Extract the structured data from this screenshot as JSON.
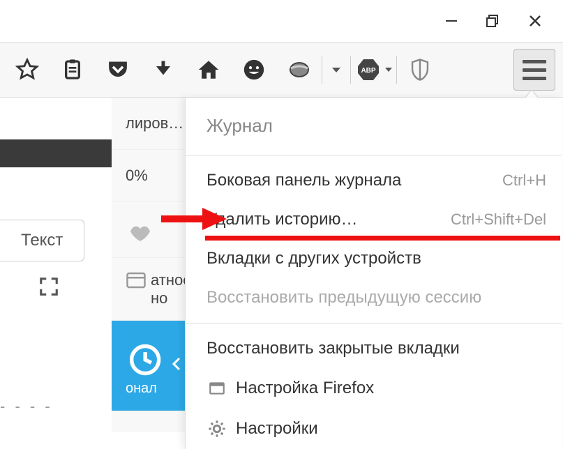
{
  "window_controls": {
    "minimize": "—",
    "maximize": "❐",
    "close": "✕"
  },
  "toolbar": {
    "icons": [
      "star",
      "clipboard",
      "pocket",
      "download",
      "home",
      "smiley",
      "ie",
      "dropdown",
      "abp",
      "shield",
      "hamburger"
    ]
  },
  "background": {
    "truncated_top": "лиров…",
    "percent": "0%",
    "tab_label": "Текст",
    "truncated_mid1": "атное",
    "truncated_mid2": "но",
    "truncated_blue": "онал",
    "dashes": "- - - -"
  },
  "sidebar": {
    "items": [
      {
        "icon": "kiss",
        "label": ""
      },
      {
        "icon": "private",
        "line1": "атное",
        "line2": "но"
      },
      {
        "icon": "history",
        "label": "онал"
      }
    ]
  },
  "menu": {
    "title": "Журнал",
    "items": [
      {
        "label": "Боковая панель журнала",
        "shortcut": "Ctrl+H",
        "interactable": true
      },
      {
        "label": "Удалить историю…",
        "shortcut": "Ctrl+Shift+Del",
        "interactable": true,
        "highlight": true
      },
      {
        "label": "Вкладки с других устройств",
        "shortcut": "",
        "interactable": true
      },
      {
        "label": "Восстановить предыдущую сессию",
        "shortcut": "",
        "interactable": false
      }
    ],
    "footer": [
      {
        "label": "Восстановить закрытые вкладки",
        "icon": "",
        "interactable": true
      },
      {
        "label": "Настройка Firefox",
        "icon": "window",
        "interactable": true
      },
      {
        "label": "Настройки",
        "icon": "gear",
        "interactable": true
      }
    ]
  }
}
